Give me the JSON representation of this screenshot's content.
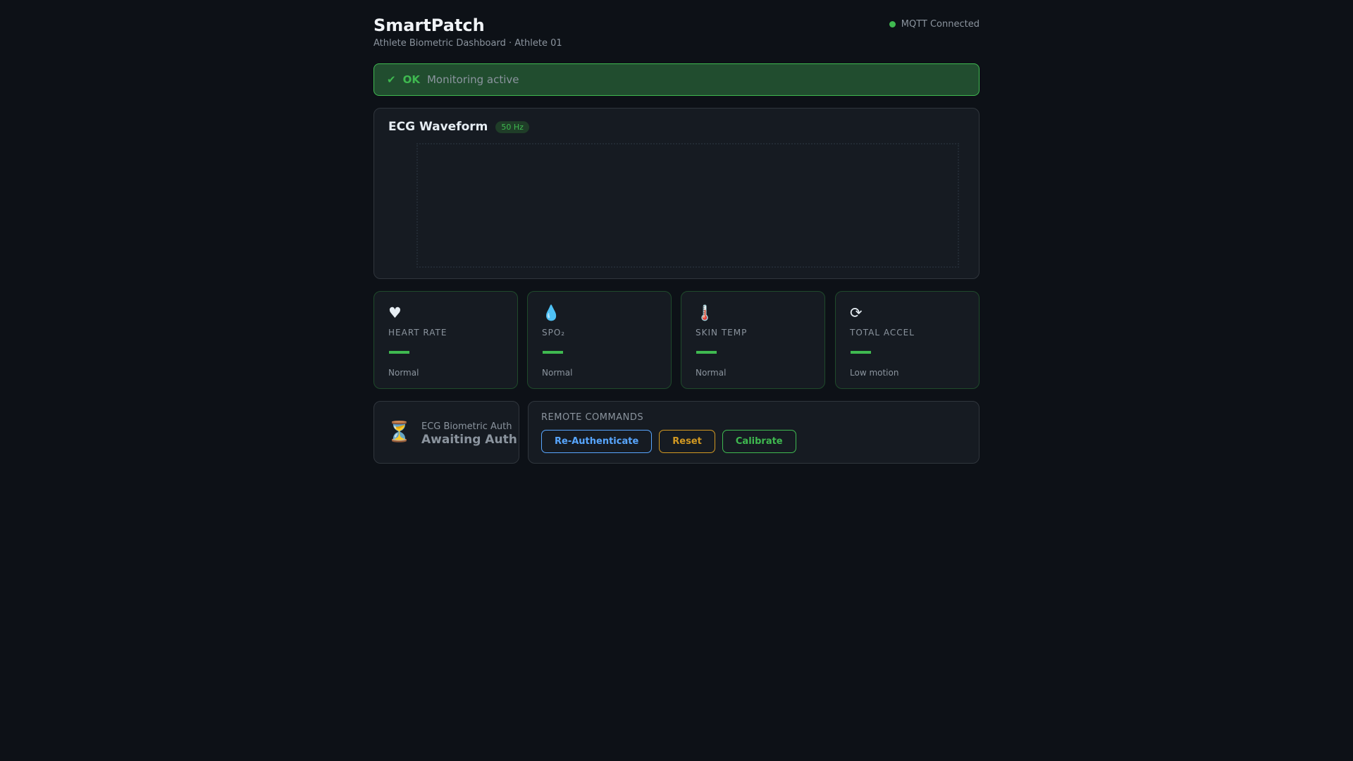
{
  "header": {
    "title": "SmartPatch",
    "subtitle": "Athlete Biometric Dashboard · Athlete 01",
    "connection": "MQTT Connected",
    "connection_color": "#3fb950"
  },
  "banner": {
    "icon": "✔",
    "status": "OK",
    "message": "Monitoring active"
  },
  "ecg": {
    "title": "ECG Waveform",
    "rate_badge": "50 Hz"
  },
  "metrics": [
    {
      "icon": "♥",
      "label": "HEART RATE",
      "status": "Normal"
    },
    {
      "icon": "💧",
      "label": "SPO₂",
      "status": "Normal"
    },
    {
      "icon": "🌡️",
      "label": "SKIN TEMP",
      "status": "Normal"
    },
    {
      "icon": "⟳",
      "label": "TOTAL ACCEL",
      "status": "Low motion"
    }
  ],
  "auth": {
    "icon": "⏳",
    "label": "ECG Biometric Auth",
    "status": "Awaiting Auth"
  },
  "commands": {
    "heading": "REMOTE COMMANDS",
    "reauth": "Re-Authenticate",
    "reset": "Reset",
    "calibrate": "Calibrate"
  }
}
